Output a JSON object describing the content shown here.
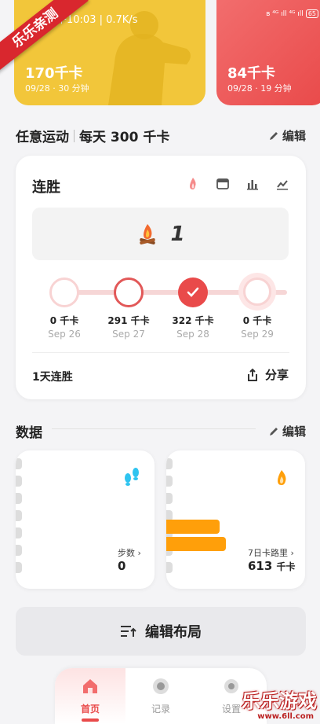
{
  "status_bar": {
    "time": "午10:03 | 0.7K/s",
    "indicators": "ʙ ⁴ᴳ ıll ⁴ᴳ ıll",
    "battery": "65"
  },
  "top_cards": [
    {
      "kcal": "170千卡",
      "meta": "09/28 · 30 分钟",
      "color": "#f2c63a"
    },
    {
      "kcal": "84千卡",
      "meta": "09/28 · 19 分钟",
      "color": "#ef5a5a"
    }
  ],
  "watermark": {
    "ribbon": "乐乐亲测",
    "brand": "乐乐游戏",
    "url": "www.6ll.com"
  },
  "goal": {
    "title": "任意运动",
    "subtitle": "每天 300 千卡",
    "edit_label": "编辑"
  },
  "streak": {
    "title": "连胜",
    "icons": [
      "flame-icon",
      "calendar-icon",
      "bar-chart-icon",
      "line-chart-icon"
    ],
    "count": "1",
    "days": [
      {
        "value": "0 千卡",
        "date": "Sep 26",
        "state": "empty"
      },
      {
        "value": "291 千卡",
        "date": "Sep 27",
        "state": "partial"
      },
      {
        "value": "322 千卡",
        "date": "Sep 28",
        "state": "done"
      },
      {
        "value": "0 千卡",
        "date": "Sep 29",
        "state": "today"
      }
    ],
    "footer": "1天连胜",
    "share_label": "分享"
  },
  "data_section": {
    "title": "数据",
    "edit_label": "编辑",
    "steps": {
      "label": "步数",
      "value": "0"
    },
    "calories7d": {
      "label": "7日卡路里",
      "value": "613",
      "unit": "千卡"
    }
  },
  "layout_button": "编辑布局",
  "nav": [
    {
      "label": "首页",
      "active": true
    },
    {
      "label": "记录",
      "active": false
    },
    {
      "label": "设置",
      "active": false
    }
  ],
  "colors": {
    "accent": "#e94a4a",
    "orange": "#ff9f0a",
    "yellow": "#f2c63a"
  }
}
